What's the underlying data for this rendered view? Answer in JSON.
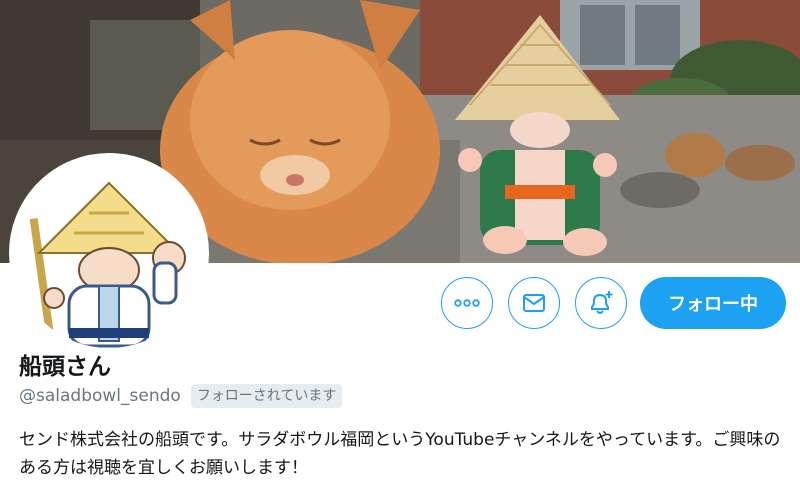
{
  "profile": {
    "display_name": "船頭さん",
    "handle": "@saladbowl_sendo",
    "follows_you_badge": "フォローされています",
    "bio": "センド株式会社の船頭です。サラダボウル福岡というYouTubeチャンネルをやっています。ご興味のある方は視聴を宜しくお願いします！"
  },
  "actions": {
    "follow_label": "フォロー中",
    "more_icon": "more-dots-icon",
    "message_icon": "envelope-icon",
    "notify_icon": "bell-plus-icon"
  },
  "colors": {
    "accent": "#1da1f2",
    "muted_text": "#657786",
    "badge_bg": "#e6ecf0"
  }
}
